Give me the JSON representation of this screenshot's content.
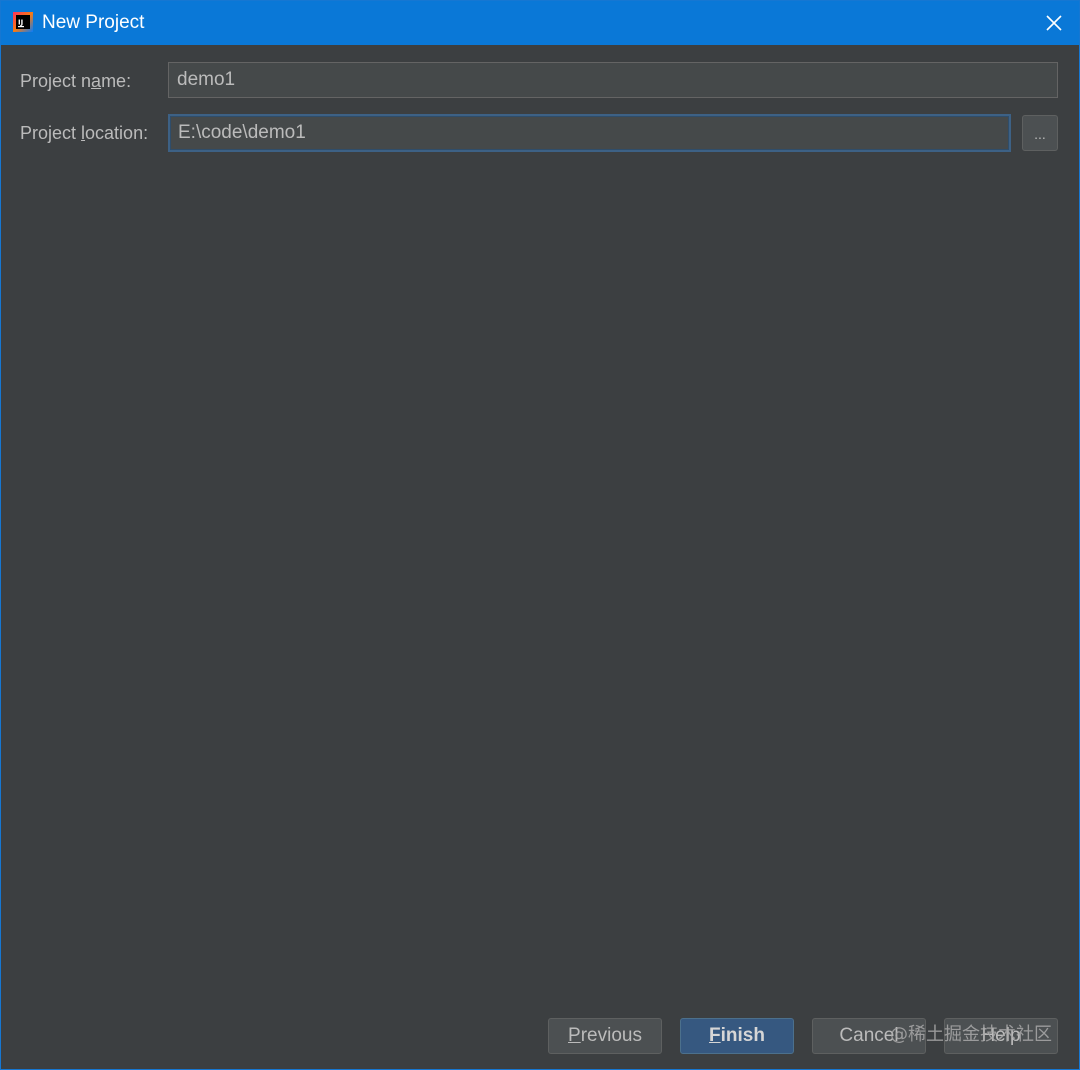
{
  "window": {
    "title": "New Project",
    "app_icon": "intellij-idea-icon",
    "accent_color": "#0a78d7"
  },
  "form": {
    "project_name": {
      "label_before": "Project n",
      "label_mnemonic": "a",
      "label_after": "me:",
      "value": "demo1"
    },
    "project_location": {
      "label_before": "Project ",
      "label_mnemonic": "l",
      "label_after": "ocation:",
      "value": "E:\\code\\demo1",
      "browse_label": "..."
    }
  },
  "buttons": {
    "previous_mnemonic": "P",
    "previous_rest": "revious",
    "finish_mnemonic": "F",
    "finish_rest": "inish",
    "cancel": "Cancel",
    "help": "Help"
  },
  "watermark": "@稀土掘金技术社区"
}
